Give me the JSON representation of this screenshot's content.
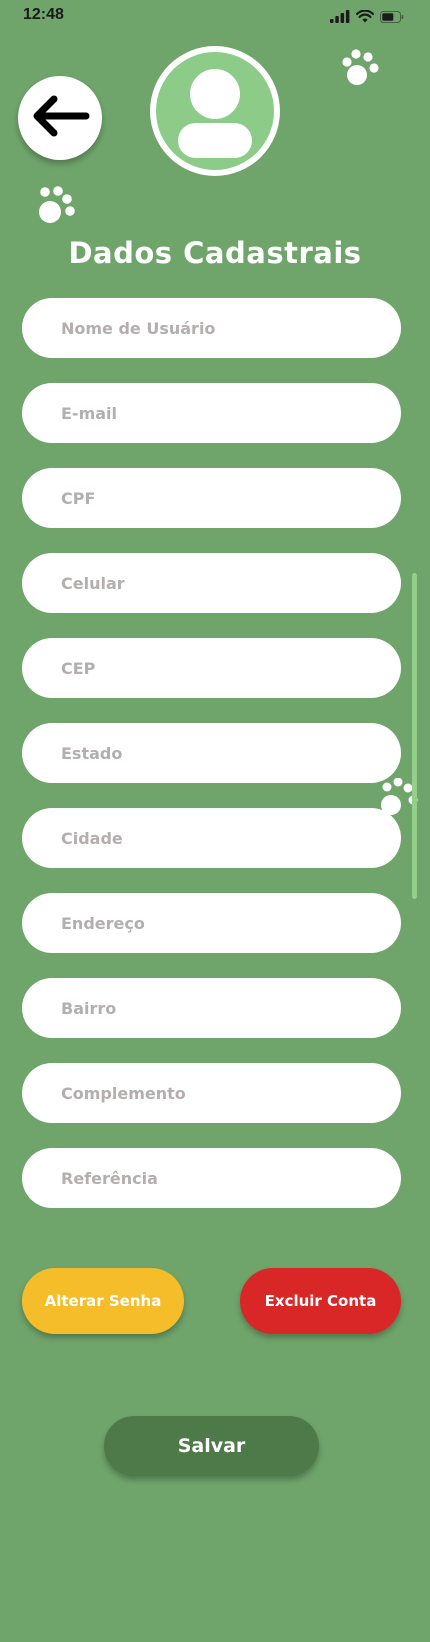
{
  "status_bar": {
    "time": "12:48"
  },
  "header": {
    "title": "Dados Cadastrais"
  },
  "form": {
    "fields": [
      {
        "placeholder": "Nome de Usuário",
        "value": ""
      },
      {
        "placeholder": "E-mail",
        "value": ""
      },
      {
        "placeholder": "CPF",
        "value": ""
      },
      {
        "placeholder": "Celular",
        "value": ""
      },
      {
        "placeholder": "CEP",
        "value": ""
      },
      {
        "placeholder": "Estado",
        "value": ""
      },
      {
        "placeholder": "Cidade",
        "value": ""
      },
      {
        "placeholder": "Endereço",
        "value": ""
      },
      {
        "placeholder": "Bairro",
        "value": ""
      },
      {
        "placeholder": "Complemento",
        "value": ""
      },
      {
        "placeholder": "Referência",
        "value": ""
      }
    ]
  },
  "actions": {
    "change_password_label": "Alterar Senha",
    "delete_account_label": "Excluir Conta",
    "save_label": "Salvar"
  },
  "icons": {
    "back": "arrow-left-icon",
    "avatar": "user-placeholder-icon",
    "decoration": "paw-print-icon",
    "signal": "cellular-signal-icon",
    "wifi": "wifi-icon",
    "battery": "battery-icon"
  },
  "colors": {
    "background": "#6fa46b",
    "avatar_fill": "#8ccc88",
    "change_password": "#f5bd2a",
    "delete_account": "#d92626",
    "save": "#4d7a48",
    "placeholder_text": "#b4aeae"
  }
}
